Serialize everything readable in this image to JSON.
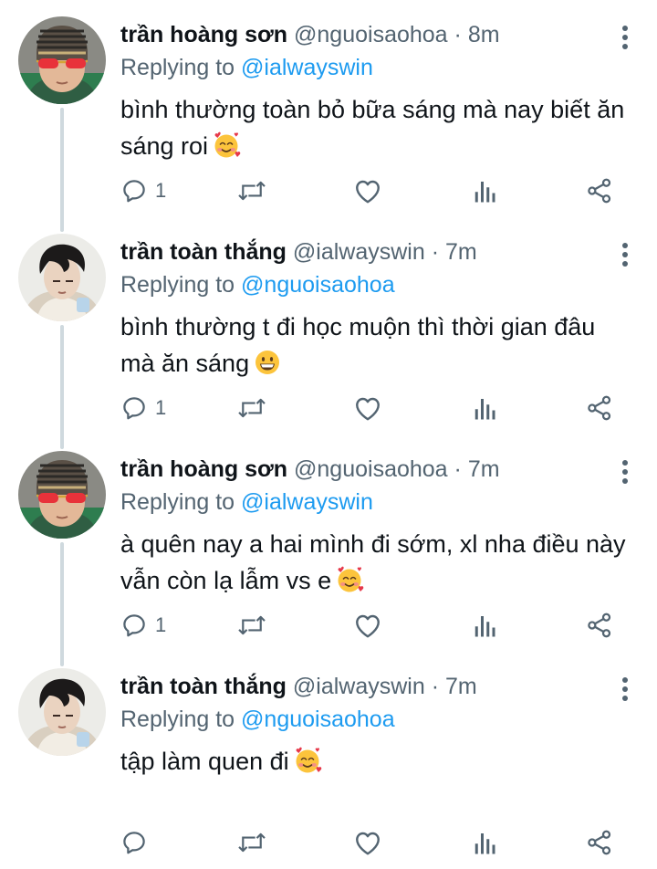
{
  "tweets": [
    {
      "avatar": "avatar-son",
      "name": "trần hoàng sơn",
      "handle": "@nguoisaohoa",
      "separator": "·",
      "time": "8m",
      "replying_prefix": "Replying to",
      "replying_to": "@ialwayswin",
      "text": "bình thường toàn bỏ bữa sáng mà nay biết ăn sáng roi",
      "emoji": "smiling-face-with-hearts",
      "reply_count": "1"
    },
    {
      "avatar": "avatar-thang",
      "name": "trần toàn thắng",
      "handle": "@ialwayswin",
      "separator": "·",
      "time": "7m",
      "replying_prefix": "Replying to",
      "replying_to": "@nguoisaohoa",
      "text": "bình thường t đi học muộn thì thời gian đâu mà ăn sáng",
      "emoji": "grinning-face",
      "reply_count": "1"
    },
    {
      "avatar": "avatar-son",
      "name": "trần hoàng sơn",
      "handle": "@nguoisaohoa",
      "separator": "·",
      "time": "7m",
      "replying_prefix": "Replying to",
      "replying_to": "@ialwayswin",
      "text": "à quên nay a hai mình đi sớm, xl nha điều này vẫn còn lạ lẫm vs e",
      "emoji": "smiling-face-with-hearts",
      "reply_count": "1"
    },
    {
      "avatar": "avatar-thang",
      "name": "trần toàn thắng",
      "handle": "@ialwayswin",
      "separator": "·",
      "time": "7m",
      "replying_prefix": "Replying to",
      "replying_to": "@nguoisaohoa",
      "text": "tập làm quen đi",
      "emoji": "smiling-face-with-hearts",
      "reply_count": ""
    }
  ],
  "colors": {
    "text": "#0f1419",
    "secondary": "#536471",
    "link": "#1d9bf0",
    "thread_line": "#cfd9de"
  },
  "icons": [
    "reply-icon",
    "retweet-icon",
    "like-icon",
    "views-icon",
    "share-icon",
    "more-icon"
  ]
}
